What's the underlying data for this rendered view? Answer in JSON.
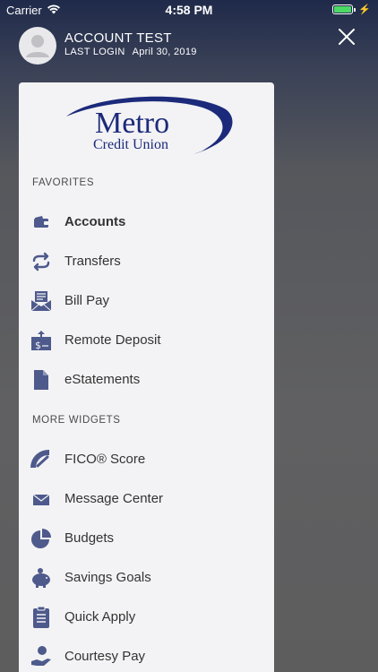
{
  "status": {
    "carrier": "Carrier",
    "time": "4:58 PM",
    "battery_level": 1.0
  },
  "user": {
    "name": "ACCOUNT  TEST",
    "last_login_label": "LAST LOGIN",
    "last_login_date": "April 30, 2019"
  },
  "logo": {
    "name": "Metro",
    "subtitle": "Credit Union"
  },
  "sections": {
    "favorites": "FAVORITES",
    "more_widgets": "MORE WIDGETS"
  },
  "favorites": [
    {
      "label": "Accounts",
      "icon": "wallet-icon",
      "active": true
    },
    {
      "label": "Transfers",
      "icon": "transfer-arrows-icon"
    },
    {
      "label": "Bill Pay",
      "icon": "bill-envelope-icon"
    },
    {
      "label": "Remote Deposit",
      "icon": "deposit-check-icon"
    },
    {
      "label": "eStatements",
      "icon": "document-icon"
    }
  ],
  "widgets": [
    {
      "label": "FICO® Score",
      "icon": "gauge-icon"
    },
    {
      "label": "Message Center",
      "icon": "envelope-icon"
    },
    {
      "label": "Budgets",
      "icon": "pie-chart-icon"
    },
    {
      "label": "Savings Goals",
      "icon": "piggy-bank-icon"
    },
    {
      "label": "Quick Apply",
      "icon": "clipboard-icon"
    },
    {
      "label": "Courtesy Pay",
      "icon": "hand-coin-icon"
    }
  ],
  "colors": {
    "icon": "#4e5a8c",
    "logo": "#1b2a7a",
    "battery": "#4cd964"
  }
}
